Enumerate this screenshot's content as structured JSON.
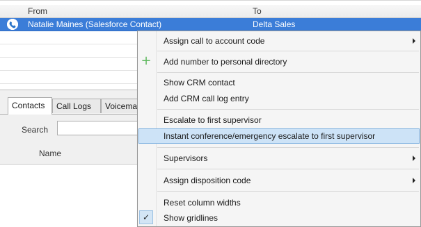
{
  "grid": {
    "headers": {
      "from": "From",
      "to": "To"
    },
    "rows": [
      {
        "from": "Natalie Maines (Salesforce Contact)",
        "to": "Delta Sales"
      }
    ]
  },
  "tabs": [
    {
      "label": "Contacts"
    },
    {
      "label": "Call Logs"
    },
    {
      "label": "Voicemail"
    }
  ],
  "search": {
    "label": "Search",
    "value": ""
  },
  "list": {
    "name_header": "Name"
  },
  "context_menu": {
    "items": [
      {
        "label": "Assign call to account code",
        "submenu": true
      },
      {
        "label": "Add number to personal directory",
        "icon": "plus-icon"
      },
      {
        "label": "Show CRM contact"
      },
      {
        "label": "Add CRM call log entry"
      },
      {
        "label": "Escalate to first supervisor"
      },
      {
        "label": "Instant conference/emergency escalate to first supervisor",
        "highlighted": true
      },
      {
        "label": "Supervisors",
        "submenu": true
      },
      {
        "label": "Assign disposition code",
        "submenu": true
      },
      {
        "label": "Reset column widths"
      },
      {
        "label": "Show gridlines",
        "checked": true
      }
    ]
  },
  "colors": {
    "selection": "#3b7dd8",
    "menu_highlight": "#cde3f7",
    "plus_icon": "#5cb85c"
  }
}
